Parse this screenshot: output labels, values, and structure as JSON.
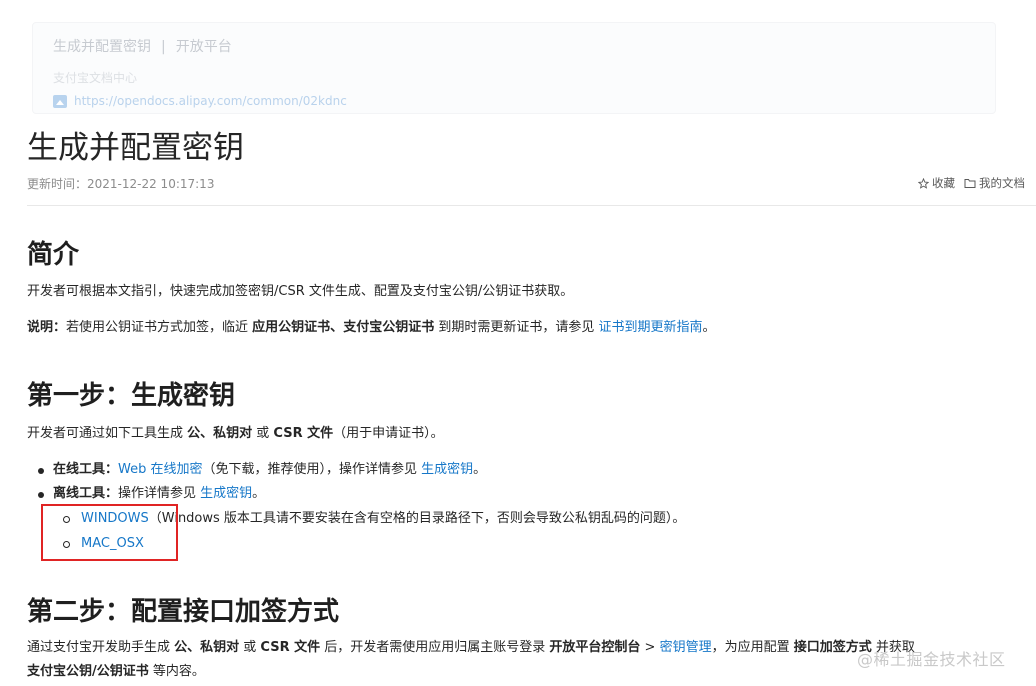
{
  "link_card": {
    "title": "生成并配置密钥",
    "separator": "|",
    "platform": "开放平台",
    "subtitle": "支付宝文档中心",
    "url": "https://opendocs.alipay.com/common/02kdnc"
  },
  "article": {
    "title": "生成并配置密钥",
    "updated": "更新时间：2021-12-22 10:17:13",
    "favorite_label": "收藏",
    "my_docs_label": "我的文档"
  },
  "intro": {
    "heading": "简介",
    "paragraph": "开发者可根据本文指引，快速完成加签密钥/CSR 文件生成、配置及支付宝公钥/公钥证书获取。",
    "note_label": "说明：",
    "note_text_1": "若使用公钥证书方式加签，临近 ",
    "note_bold_1": "应用公钥证书",
    "note_sep": "、",
    "note_bold_2": "支付宝公钥证书",
    "note_text_2": " 到期时需更新证书，请参见 ",
    "note_link": "证书到期更新指南",
    "note_end": "。"
  },
  "step1": {
    "heading": "第一步：生成密钥",
    "p_1": "开发者可通过如下工具生成 ",
    "p_bold_1": "公、私钥对",
    "p_2": " 或 ",
    "p_bold_2": "CSR 文件",
    "p_3": "（用于申请证书）。",
    "online_label": "在线工具：",
    "online_link": "Web 在线加密",
    "online_text": "（免下载，推荐使用），操作详情参见 ",
    "online_link2": "生成密钥",
    "online_end": "。",
    "offline_label": "离线工具：",
    "offline_text": "操作详情参见 ",
    "offline_link": "生成密钥",
    "offline_end": "。",
    "windows_link": "WINDOWS",
    "windows_text": "（Windows 版本工具请不要安装在含有空格的目录路径下，否则会导致公私钥乱码的问题）。",
    "mac_link": "MAC_OSX"
  },
  "step2": {
    "heading": "第二步：配置接口加签方式",
    "p_1": "通过支付宝开发助手生成 ",
    "p_bold_1": "公、私钥对",
    "p_2": " 或 ",
    "p_bold_2": "CSR 文件",
    "p_3": " 后，开发者需使用应用归属主账号登录 ",
    "p_bold_3": "开放平台控制台",
    "p_4": " > ",
    "p_link": "密钥管理",
    "p_5": "，为应用配置 ",
    "p_bold_4": "接口加签方式",
    "p_6": " 并获取",
    "line2_bold": "支付宝公钥/公钥证书",
    "line2_text": " 等内容。"
  },
  "watermark": "@稀土掘金技术社区",
  "colors": {
    "link": "#1677c8",
    "highlight_box": "#e02424",
    "text": "#262626"
  }
}
